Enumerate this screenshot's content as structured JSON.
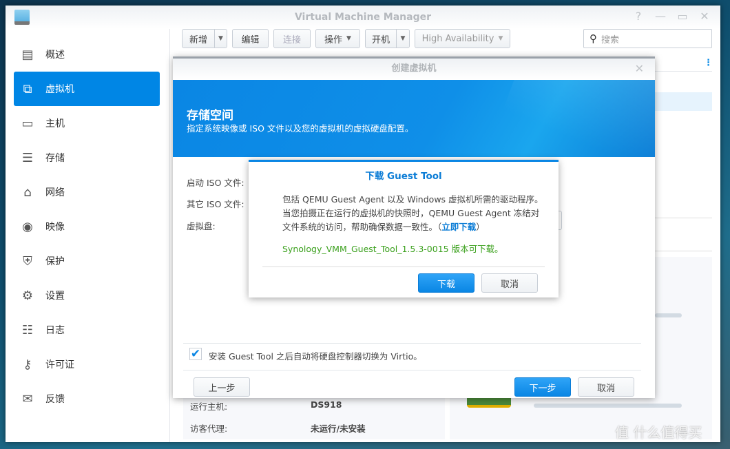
{
  "window": {
    "title": "Virtual Machine Manager"
  },
  "sidebar": {
    "items": [
      {
        "label": "概述",
        "icon": "overview-icon",
        "glyph": "▤"
      },
      {
        "label": "虚拟机",
        "icon": "virtual-machine-icon",
        "glyph": "⧉",
        "selected": true
      },
      {
        "label": "主机",
        "icon": "host-icon",
        "glyph": "▭"
      },
      {
        "label": "存储",
        "icon": "storage-icon",
        "glyph": "☰"
      },
      {
        "label": "网络",
        "icon": "network-icon",
        "glyph": "⌂"
      },
      {
        "label": "映像",
        "icon": "image-icon",
        "glyph": "◉"
      },
      {
        "label": "保护",
        "icon": "protection-icon",
        "glyph": "⛨"
      },
      {
        "label": "设置",
        "icon": "gear-icon",
        "glyph": "⚙"
      },
      {
        "label": "日志",
        "icon": "log-icon",
        "glyph": "☷"
      },
      {
        "label": "许可证",
        "icon": "key-icon",
        "glyph": "⚷"
      },
      {
        "label": "反馈",
        "icon": "mail-icon",
        "glyph": "✉"
      }
    ]
  },
  "toolbar": {
    "new": "新增",
    "edit": "编辑",
    "connect": "连接",
    "action": "操作",
    "power_on": "开机",
    "ha": "High Availability",
    "search_placeholder": "搜索"
  },
  "background_info": {
    "host_label": "运行主机:",
    "host_value": "DS918",
    "agent_label": "访客代理:",
    "agent_value": "未运行/未安装"
  },
  "wizard": {
    "title": "创建虚拟机",
    "banner_title": "存储空间",
    "banner_subtitle": "指定系统映像或 ISO 文件以及您的虚拟机的虚拟硬盘配置。",
    "boot_iso_label": "启动 ISO 文件:",
    "other_iso_label": "其它 ISO 文件:",
    "virtual_disk_label": "虚拟盘:",
    "checkbox_label": "安装 Guest Tool 之后自动将硬盘控制器切换为 Virtio。",
    "checkbox_checked": true,
    "back": "上一步",
    "next": "下一步",
    "cancel": "取消"
  },
  "guest_dialog": {
    "title": "下载 Guest Tool",
    "line1": "包括 QEMU Guest Agent 以及 Windows 虚拟机所需的驱动程序。",
    "line2": "当您拍摄正在运行的虚拟机的快照时，QEMU Guest Agent 冻结对",
    "line3_pre": "文件系统的访问，帮助确保数据一致性。（",
    "link": "立即下载",
    "line3_post": "）",
    "version_note": "Synology_VMM_Guest_Tool_1.5.3-0015 版本可下载。",
    "download": "下载",
    "cancel": "取消"
  },
  "watermark": "值 什么值得买",
  "colors": {
    "accent": "#0086e5",
    "green": "#3aa01c"
  }
}
